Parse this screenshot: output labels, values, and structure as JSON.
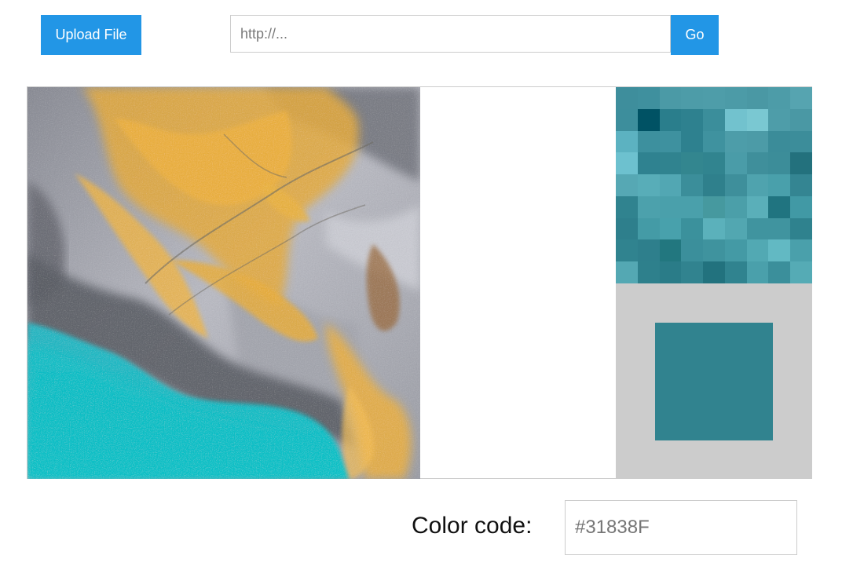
{
  "toolbar": {
    "upload_label": "Upload File",
    "url_placeholder": "http://...",
    "url_value": "",
    "go_label": "Go"
  },
  "picker": {
    "color_label": "Color code:",
    "color_value": "#31838F",
    "swatch_color": "#31838F",
    "zoom_background": "#cccccc",
    "zoom_cells": [
      [
        "#3e8e9c",
        "#3f909e",
        "#4b9aa6",
        "#4d9ca8",
        "#4e9da9",
        "#4c9ba7",
        "#4a98a4",
        "#4d9ca8",
        "#56a4b0"
      ],
      [
        "#3d8e9c",
        "#005264",
        "#2a7e8c",
        "#2e818f",
        "#3b8e9b",
        "#72c2ce",
        "#7ac8d2",
        "#4e9da9",
        "#4a98a4"
      ],
      [
        "#5cb2c1",
        "#3d909e",
        "#3e919f",
        "#2e818f",
        "#3f929f",
        "#4d9da9",
        "#4c9ba7",
        "#3b8c99",
        "#3c8d9a"
      ],
      [
        "#6dc1cf",
        "#2f8290",
        "#30838f",
        "#33868f",
        "#31848f",
        "#4a9ca8",
        "#3f8f9b",
        "#3c8d99",
        "#23717d"
      ],
      [
        "#56a8b4",
        "#58adb8",
        "#52a7b3",
        "#3b8e9a",
        "#2f808c",
        "#3e8f9b",
        "#4fa3ae",
        "#49a0ab",
        "#348592"
      ],
      [
        "#30838f",
        "#4ca1ac",
        "#4aa0ab",
        "#4aa0ab",
        "#46999f",
        "#4b9fa9",
        "#5aafb9",
        "#207480",
        "#4199a5"
      ],
      [
        "#2e7f8c",
        "#449ba6",
        "#48a1ac",
        "#3b919c",
        "#5bb1bb",
        "#52a7b1",
        "#40949f",
        "#40949f",
        "#2f828e"
      ],
      [
        "#30838f",
        "#2e7f8c",
        "#22777f",
        "#3b8f9b",
        "#3f939e",
        "#449aa5",
        "#52a9b3",
        "#62b9c3",
        "#4aa0ab"
      ],
      [
        "#54a8b3",
        "#2e808c",
        "#2a7c88",
        "#31838f",
        "#22727e",
        "#30838f",
        "#4aa0ab",
        "#3b8f9b",
        "#55abb5"
      ]
    ]
  }
}
